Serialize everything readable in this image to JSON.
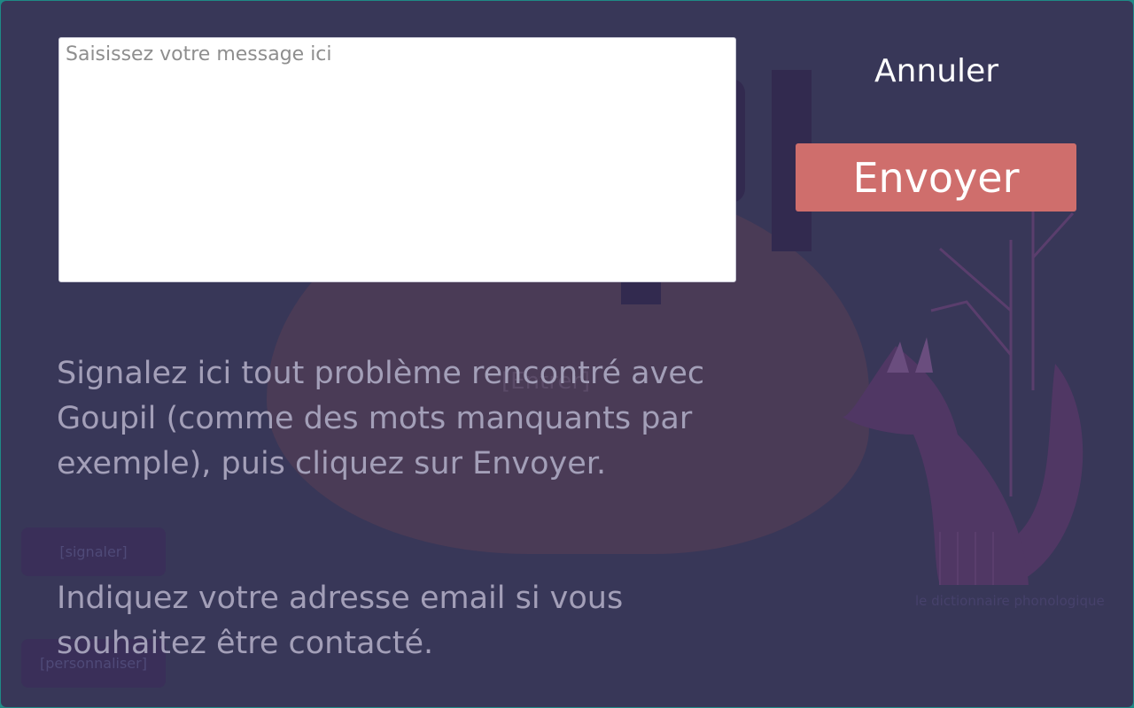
{
  "dialog": {
    "message_placeholder": "Saisissez votre message ici",
    "cancel_label": "Annuler",
    "send_label": "Envoyer",
    "info_report": "Signalez ici tout problème rencontré avec Goupil (comme des mots manquants par exemple), puis cliquez sur Envoyer.",
    "info_contact": "Indiquez votre adresse email si vous souhaitez être contacté."
  },
  "background": {
    "enter_label": "[Entrer]",
    "report_label": "[signaler]",
    "customize_label": "[personnaliser]",
    "tagline": "le dictionnaire phonologique"
  },
  "colors": {
    "overlay": "#383758",
    "send_button": "#cf6e6c",
    "info_text": "#a39fb8",
    "frame_border": "#1f8a86"
  },
  "icons": {
    "mascot": "fox-illustration"
  }
}
